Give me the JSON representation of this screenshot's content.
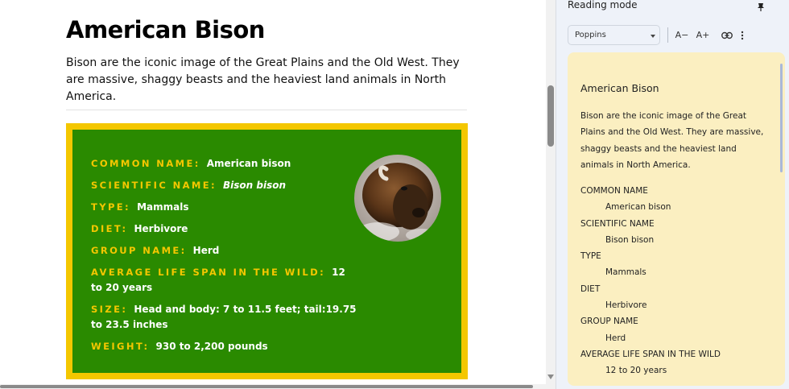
{
  "article": {
    "title": "American Bison",
    "intro": "Bison are the iconic image of the Great Plains and the Old West. They are massive, shaggy beasts and the heaviest land animals in North America.",
    "facts": [
      {
        "label": "COMMON NAME:",
        "value": "American bison"
      },
      {
        "label": "SCIENTIFIC NAME:",
        "value": "Bison bison"
      },
      {
        "label": "TYPE:",
        "value": "Mammals"
      },
      {
        "label": "DIET:",
        "value": "Herbivore"
      },
      {
        "label": "GROUP NAME:",
        "value": "Herd"
      },
      {
        "label": "AVERAGE LIFE SPAN IN THE WILD:",
        "value": "12 to 20 years"
      },
      {
        "label": "SIZE:",
        "value": "Head and body: 7 to 11.5 feet; tail:19.75 to 23.5 inches"
      },
      {
        "label": "WEIGHT:",
        "value": "930 to 2,200 pounds"
      }
    ],
    "colors": {
      "box_border": "#f4c700",
      "box_bg": "#2a8a00",
      "label": "#f4c700"
    }
  },
  "panel": {
    "header": "Reading mode",
    "font_select": "Poppins",
    "decrease_font": "A−",
    "increase_font": "A+",
    "icons": {
      "pin": "pin-icon",
      "link": "link-icon",
      "more": "more-vert-icon"
    },
    "content": {
      "title": "American Bison",
      "body": "Bison are the iconic image of the Great Plains and the Old West. They are massive, shaggy beasts and the heaviest land animals in North America.",
      "list": [
        {
          "label": "COMMON NAME",
          "value": "American bison"
        },
        {
          "label": "SCIENTIFIC NAME",
          "value": "Bison bison"
        },
        {
          "label": "TYPE",
          "value": "Mammals"
        },
        {
          "label": "DIET",
          "value": "Herbivore"
        },
        {
          "label": "GROUP NAME",
          "value": "Herd"
        },
        {
          "label": "AVERAGE LIFE SPAN IN THE WILD",
          "value": "12 to 20 years"
        }
      ]
    },
    "colors": {
      "panel_bg": "#eef2f9",
      "content_bg": "#fbefc1"
    }
  }
}
